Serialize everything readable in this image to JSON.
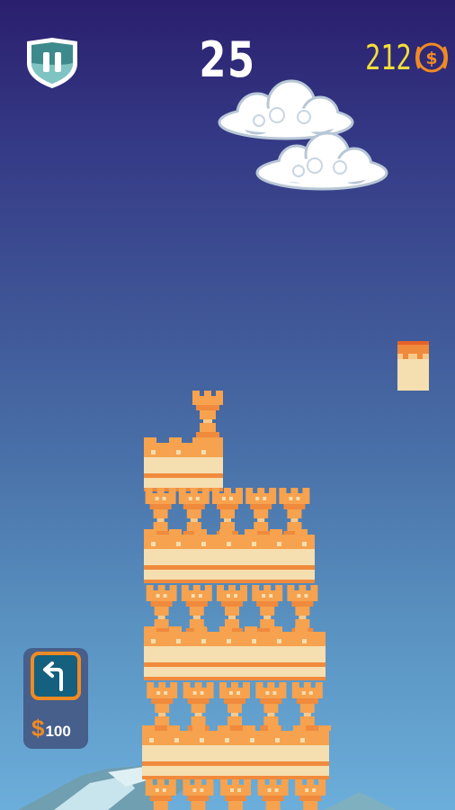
{
  "hud": {
    "score": "25",
    "coins": "212",
    "pause_icon": "pause-icon",
    "coin_icon": "dollar-coin-icon"
  },
  "undo": {
    "icon": "undo-arrow-icon",
    "currency": "$",
    "price": "100"
  },
  "colors": {
    "sky_top": "#2a1f6e",
    "sky_bottom": "#6caedb",
    "block_orange": "#f6a24e",
    "block_cream": "#f5deb0",
    "score_text": "#ffffff",
    "coin_text": "#f2de3a",
    "accent": "#f08a24"
  }
}
